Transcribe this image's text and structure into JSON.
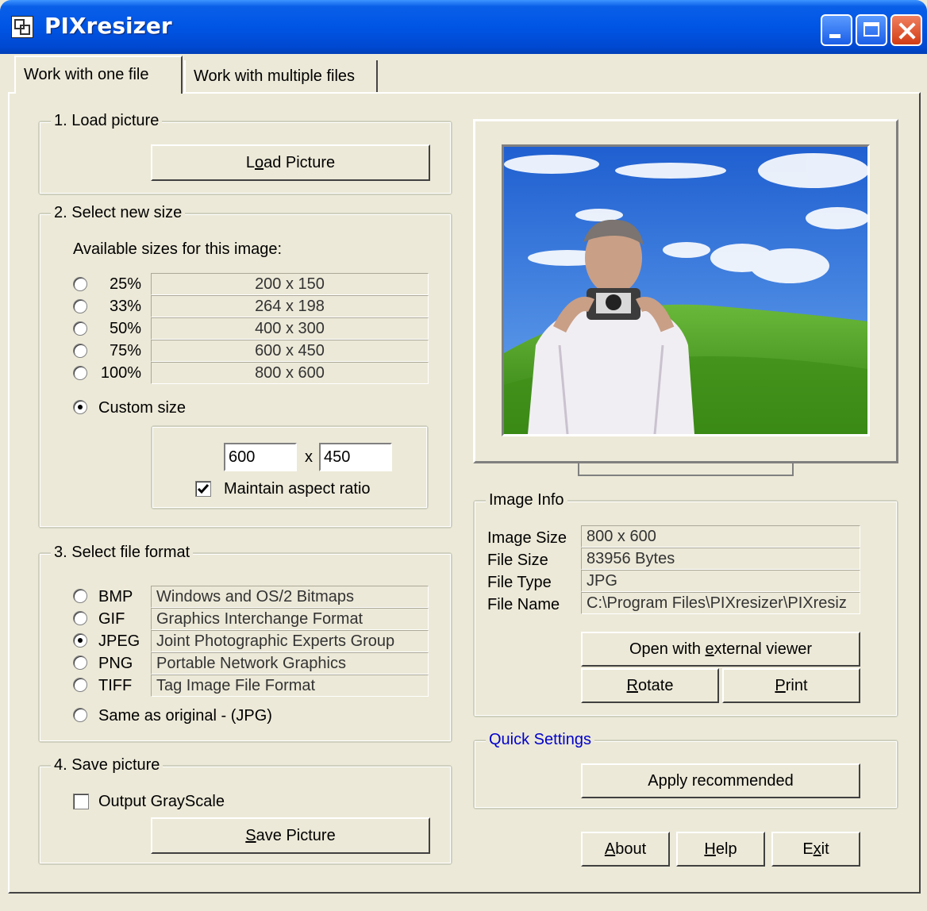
{
  "window": {
    "title": "PIXresizer"
  },
  "tabs": [
    {
      "label": "Work with one file",
      "selected": true
    },
    {
      "label": "Work with multiple files",
      "selected": false
    }
  ],
  "load": {
    "legend": "1. Load picture",
    "button": {
      "pre": "L",
      "u": "o",
      "post": "ad Picture"
    }
  },
  "size": {
    "legend": "2. Select new size",
    "heading": "Available sizes for this image:",
    "options": [
      {
        "pct": "25%",
        "dims": "200 x 150",
        "selected": false
      },
      {
        "pct": "33%",
        "dims": "264 x 198",
        "selected": false
      },
      {
        "pct": "50%",
        "dims": "400 x 300",
        "selected": false
      },
      {
        "pct": "75%",
        "dims": "600 x 450",
        "selected": false
      },
      {
        "pct": "100%",
        "dims": "800 x 600",
        "selected": false
      }
    ],
    "custom_label": "Custom size",
    "custom_selected": true,
    "width": "600",
    "x_label": "x",
    "height": "450",
    "maintain_label": "Maintain aspect ratio",
    "maintain_checked": true
  },
  "format": {
    "legend": "3. Select file format",
    "options": [
      {
        "code": "BMP",
        "desc": "Windows and OS/2 Bitmaps",
        "selected": false
      },
      {
        "code": "GIF",
        "desc": "Graphics Interchange Format",
        "selected": false
      },
      {
        "code": "JPEG",
        "desc": "Joint Photographic Experts Group",
        "selected": true
      },
      {
        "code": "PNG",
        "desc": "Portable Network Graphics",
        "selected": false
      },
      {
        "code": "TIFF",
        "desc": "Tag Image File Format",
        "selected": false
      }
    ],
    "same_label": "Same as original  - (JPG)"
  },
  "save": {
    "legend": "4. Save picture",
    "grayscale_label": "Output GrayScale",
    "grayscale_checked": false,
    "button": {
      "pre": "",
      "u": "S",
      "post": "ave Picture"
    }
  },
  "info": {
    "legend": "Image Info",
    "rows": [
      {
        "label": "Image Size",
        "value": "800 x 600"
      },
      {
        "label": "File Size",
        "value": "83956 Bytes"
      },
      {
        "label": "File Type",
        "value": "JPG"
      },
      {
        "label": "File Name",
        "value": "C:\\Program Files\\PIXresizer\\PIXresiz"
      }
    ],
    "open_button": {
      "pre": "Open with ",
      "u": "e",
      "post": "xternal viewer"
    },
    "rotate_button": {
      "pre": "",
      "u": "R",
      "post": "otate"
    },
    "print_button": {
      "pre": "",
      "u": "P",
      "post": "rint"
    }
  },
  "quick": {
    "legend": "Quick Settings",
    "legend_color": "#0000cc",
    "button": "Apply recommended"
  },
  "footer": {
    "about": {
      "pre": "",
      "u": "A",
      "post": "bout"
    },
    "help": {
      "pre": "",
      "u": "H",
      "post": "elp"
    },
    "exit": {
      "pre": "E",
      "u": "x",
      "post": "it"
    }
  },
  "colors": {
    "titlebar": "#0055e5",
    "face": "#ece9d8",
    "sky": "#2f6fd8",
    "grass": "#4e9a1e"
  }
}
